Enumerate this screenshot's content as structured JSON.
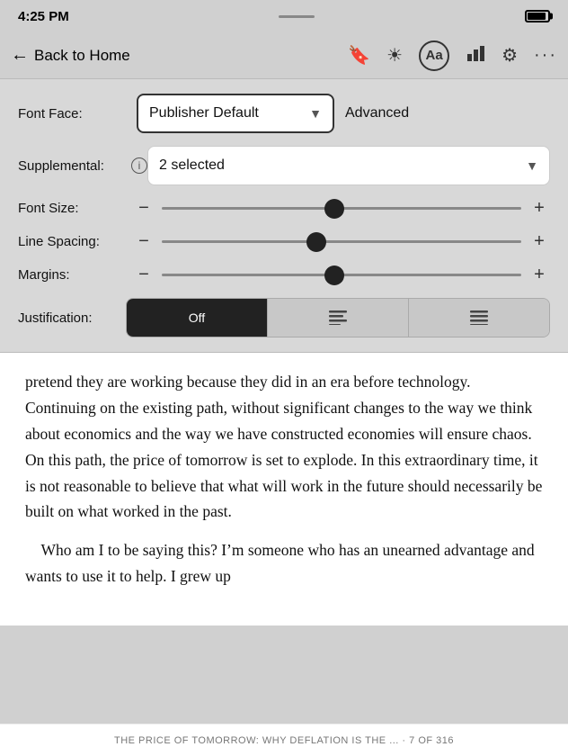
{
  "statusBar": {
    "time": "4:25 PM"
  },
  "navBar": {
    "backLabel": "Back to Home",
    "icons": {
      "bookmark": "🔖",
      "brightness": "☀",
      "aa": "Aa",
      "chart": "📊",
      "gear": "⚙",
      "more": "···"
    }
  },
  "settings": {
    "fontFaceLabel": "Font Face:",
    "fontFaceValue": "Publisher Default",
    "advancedLabel": "Advanced",
    "supplementalLabel": "Supplemental:",
    "supplementalValue": "2 selected",
    "fontSizeLabel": "Font Size:",
    "fontSizeThumbPct": 48,
    "lineSpacingLabel": "Line Spacing:",
    "lineSpacingThumbPct": 43,
    "marginsLabel": "Margins:",
    "marginsThumbPct": 48,
    "justificationLabel": "Justification:",
    "justButtons": [
      "Off",
      "≡",
      "≡"
    ],
    "justActiveIndex": 0
  },
  "reading": {
    "paragraph1": "pretend they are working because they did in an era before technology. Continuing on the existing path, without significant changes to the way we think about economics and the way we have constructed economies will ensure chaos. On this path, the price of tomorrow is set to explode. In this extraordinary time, it is not reasonable to believe that what will work in the future should necessarily be built on what worked in the past.",
    "paragraph2": "    Who am I to be saying this? I’m someone who has an unearned advantage and wants to use it to help. I grew up"
  },
  "footer": {
    "text": "THE PRICE OF TOMORROW: WHY DEFLATION IS THE ... · 7 OF 316"
  }
}
